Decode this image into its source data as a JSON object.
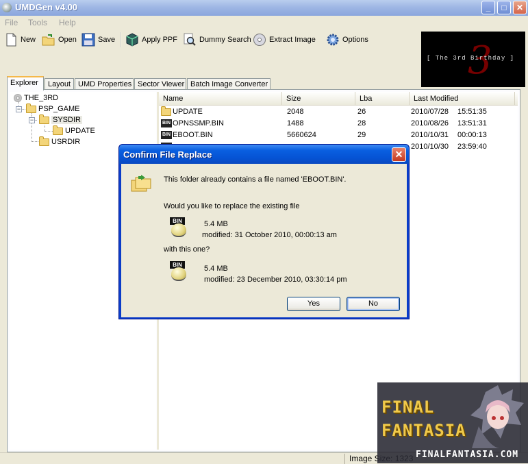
{
  "window": {
    "title": "UMDGen v4.00",
    "controls": {
      "minimize": "_",
      "maximize": "□",
      "close": "✕"
    }
  },
  "menu": [
    "File",
    "Tools",
    "Help"
  ],
  "toolbar": {
    "new": "New",
    "open": "Open",
    "save": "Save",
    "apply_ppf": "Apply PPF",
    "dummy_search": "Dummy Search",
    "extract_image": "Extract Image",
    "options": "Options"
  },
  "banner": {
    "text": "[ The 3rd Birthday ]",
    "glyph": "3"
  },
  "tabs": [
    "Explorer",
    "Layout",
    "UMD Properties",
    "Sector Viewer",
    "Batch Image Converter"
  ],
  "tree": {
    "root": "THE_3RD",
    "psp_game": "PSP_GAME",
    "sysdir": "SYSDIR",
    "update": "UPDATE",
    "usrdir": "USRDIR",
    "expander_minus": "−"
  },
  "filelist": {
    "columns": [
      "Name",
      "Size",
      "Lba",
      "Last Modified"
    ],
    "rows": [
      {
        "icon": "folder",
        "name": "UPDATE",
        "size": "2048",
        "lba": "26",
        "date": "2010/07/28",
        "time": "15:51:35"
      },
      {
        "icon": "bin",
        "name": "OPNSSMP.BIN",
        "size": "1488",
        "lba": "28",
        "date": "2010/08/26",
        "time": "13:51:31"
      },
      {
        "icon": "bin",
        "name": "EBOOT.BIN",
        "size": "5660624",
        "lba": "29",
        "date": "2010/10/31",
        "time": "00:00:13"
      },
      {
        "icon": "bin",
        "name": "",
        "size": "",
        "lba": "",
        "date": "2010/10/30",
        "time": "23:59:40"
      }
    ]
  },
  "statusbar": {
    "image_size": "Image Size: 1323"
  },
  "dialog": {
    "title": "Confirm File Replace",
    "close": "✕",
    "message": "This folder already contains a file named 'EBOOT.BIN'.",
    "question": "Would you like to replace the existing file",
    "existing": {
      "icon_label": "BIN",
      "size": "5.4 MB",
      "modified": "modified: 31 October 2010, 00:00:13 am"
    },
    "with_this": "with this one?",
    "new_file": {
      "icon_label": "BIN",
      "size": "5.4 MB",
      "modified": "modified: 23 December 2010, 03:30:14 pm"
    },
    "yes": "Yes",
    "no": "No"
  },
  "watermark": {
    "line1": "FINAL",
    "line2": "FANTASIA",
    "url": "FINALFANTASIA.COM"
  },
  "colors": {
    "titlebar": "#9fb7e4",
    "dialog_title": "#0553d4",
    "dialog_border": "#0a3cc8",
    "face": "#ece9d8"
  }
}
